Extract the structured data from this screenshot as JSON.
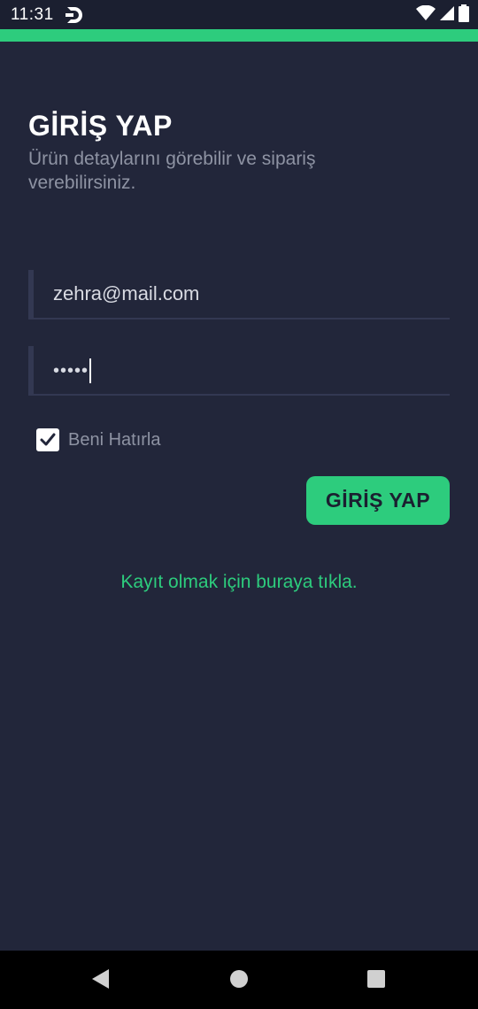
{
  "status_bar": {
    "time": "11:31",
    "app_icon": "app-logo-icon",
    "icons": [
      "wifi-icon",
      "signal-icon",
      "battery-icon"
    ]
  },
  "login": {
    "title": "GİRİŞ YAP",
    "subtitle": "Ürün detaylarını görebilir ve sipariş verebilirsiniz.",
    "email_value": "zehra@mail.com",
    "password_masked": "•••••",
    "remember_label": "Beni Hatırla",
    "remember_checked": true,
    "submit_label": "GİRİŞ YAP",
    "register_link": "Kayıt olmak için buraya tıkla."
  },
  "nav_bar": {
    "buttons": [
      "back-icon",
      "home-icon",
      "recents-icon"
    ]
  },
  "colors": {
    "background": "#22263a",
    "accent": "#2dcc7d",
    "muted_text": "#8e93a3",
    "field_line": "#333852"
  }
}
